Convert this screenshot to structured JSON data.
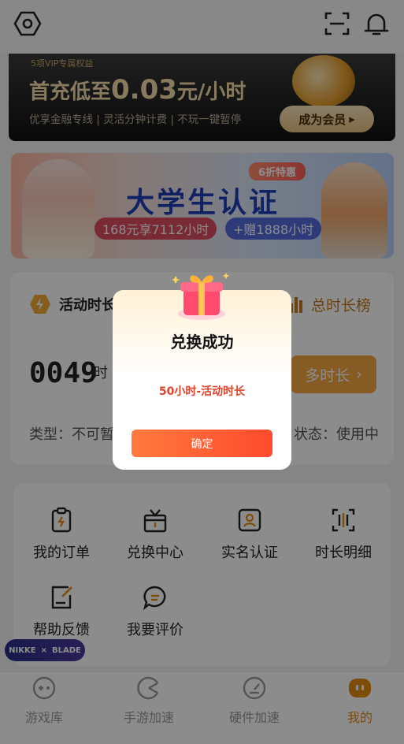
{
  "topbar": {
    "icons": [
      "settings-hex-icon",
      "scan-icon",
      "bell-icon"
    ]
  },
  "vip_banner": {
    "tagline": "5项VIP专属权益",
    "headline_prefix": "首充低至",
    "headline_price": "0.03",
    "headline_suffix": "元/小时",
    "perks": "优享金融专线 | 灵活分钟计费 | 不玩一键暂停",
    "button_label": "成为会员",
    "button_arrow": "▸"
  },
  "student_banner": {
    "discount_tag": "6折特惠",
    "title": "大学生认证",
    "price_text": "168元享7112小时",
    "bonus_text": "+赠1888小时"
  },
  "activity_card": {
    "label": "活动时长",
    "rank_label": "总时长榜",
    "hours": "0049",
    "hours_unit": "时",
    "more_button": "多时长",
    "more_arrow": "›",
    "type_text": "类型：不可暂停",
    "state_text": "状态：使用中"
  },
  "menu": {
    "items": [
      {
        "label": "我的订单",
        "icon": "order-icon"
      },
      {
        "label": "兑换中心",
        "icon": "gift-box-icon"
      },
      {
        "label": "实名认证",
        "icon": "id-card-icon"
      },
      {
        "label": "时长明细",
        "icon": "time-detail-icon"
      },
      {
        "label": "帮助反馈",
        "icon": "feedback-icon"
      },
      {
        "label": "我要评价",
        "icon": "comment-icon"
      }
    ]
  },
  "promo_badge": {
    "left": "NIKKE",
    "sep": "×",
    "right": "BLADE"
  },
  "tabbar": {
    "tabs": [
      {
        "label": "游戏库",
        "icon": "gamepad-icon",
        "active": false
      },
      {
        "label": "手游加速",
        "icon": "pacman-icon",
        "active": false
      },
      {
        "label": "硬件加速",
        "icon": "speedometer-icon",
        "active": false
      },
      {
        "label": "我的",
        "icon": "profile-icon",
        "active": true
      }
    ]
  },
  "dialog": {
    "title": "兑换成功",
    "reward": "50小时-活动时长",
    "confirm_label": "确定"
  },
  "colors": {
    "accent_orange": "#f4a742",
    "dialog_button": "#ff4a2f",
    "reward_red": "#e0442c",
    "active_tab": "#e38a12"
  }
}
